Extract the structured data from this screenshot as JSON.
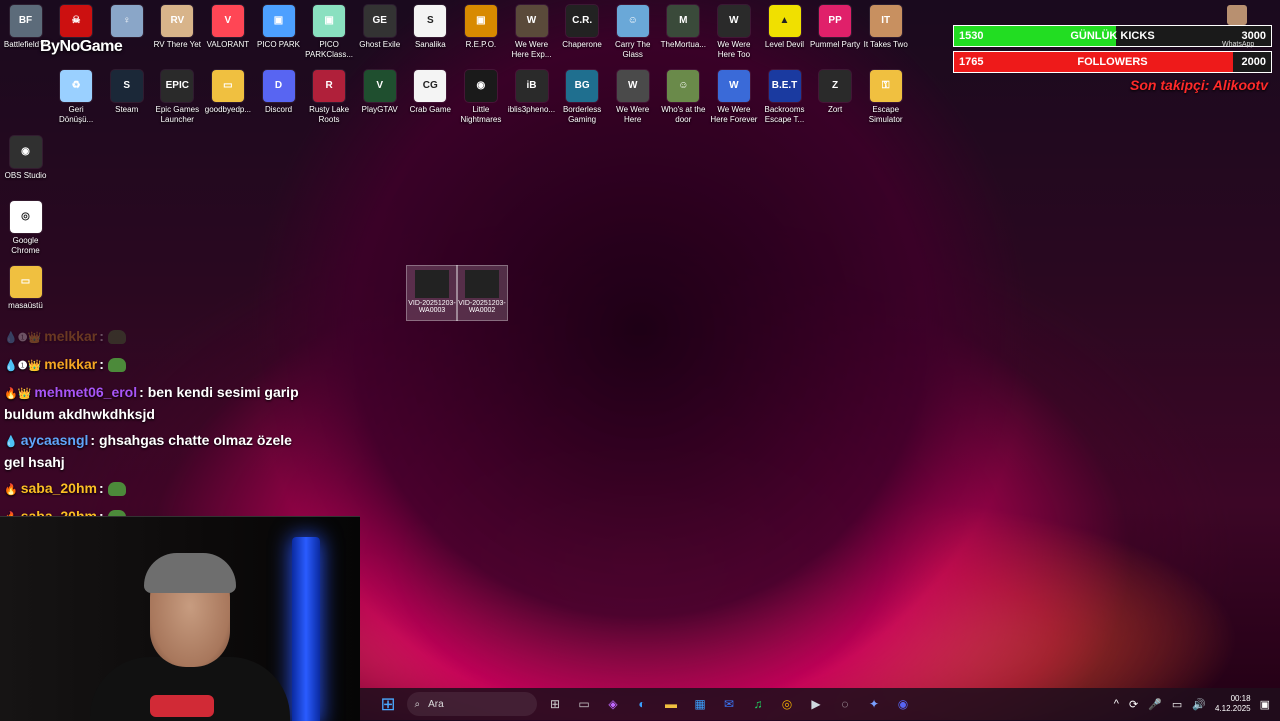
{
  "desktop_row1": [
    {
      "label": "Battlefield™",
      "color": "#5c6b7a",
      "glyph": "BF"
    },
    {
      "label": "",
      "color": "#cc1010",
      "glyph": "☠"
    },
    {
      "label": "",
      "color": "#8aa6c8",
      "glyph": "♀"
    },
    {
      "label": "RV There Yet",
      "color": "#d8b48a",
      "glyph": "RV"
    },
    {
      "label": "VALORANT",
      "color": "#ff4655",
      "glyph": "V"
    },
    {
      "label": "PICO PARK",
      "color": "#4da0ff",
      "glyph": "▣"
    },
    {
      "label": "PICO PARKClass...",
      "color": "#8ae0c0",
      "glyph": "▣"
    },
    {
      "label": "Ghost Exile",
      "color": "#333333",
      "glyph": "GE"
    },
    {
      "label": "Sanalika",
      "color": "#f4f4f4",
      "glyph": "S"
    },
    {
      "label": "R.E.P.O.",
      "color": "#d88a00",
      "glyph": "▣"
    },
    {
      "label": "We Were Here Exp...",
      "color": "#5a4a3a",
      "glyph": "W"
    },
    {
      "label": "Chaperone",
      "color": "#222222",
      "glyph": "C.R."
    },
    {
      "label": "Carry The Glass",
      "color": "#6aa8d8",
      "glyph": "☺"
    },
    {
      "label": "TheMortua...",
      "color": "#3a4a3a",
      "glyph": "M"
    },
    {
      "label": "We Were Here Too",
      "color": "#2a2a2a",
      "glyph": "W"
    },
    {
      "label": "Level Devil",
      "color": "#f0e000",
      "glyph": "▲"
    },
    {
      "label": "Pummel Party",
      "color": "#e0206a",
      "glyph": "PP"
    },
    {
      "label": "It Takes Two",
      "color": "#c89060",
      "glyph": "IT"
    }
  ],
  "desktop_row2": [
    {
      "label": "Geri Dönüşü...",
      "color": "#9ad0ff",
      "glyph": "♻"
    },
    {
      "label": "Steam",
      "color": "#1b2838",
      "glyph": "S"
    },
    {
      "label": "Epic Games Launcher",
      "color": "#2a2a2a",
      "glyph": "EPIC"
    },
    {
      "label": "goodbyedp...",
      "color": "#f0c040",
      "glyph": "▭"
    },
    {
      "label": "Discord",
      "color": "#5865f2",
      "glyph": "D"
    },
    {
      "label": "Rusty Lake Roots",
      "color": "#b0203a",
      "glyph": "R"
    },
    {
      "label": "PlayGTAV",
      "color": "#1f4f2f",
      "glyph": "V"
    },
    {
      "label": "Crab Game",
      "color": "#f4f4f4",
      "glyph": "CG"
    },
    {
      "label": "Little Nightmares",
      "color": "#1a1a1a",
      "glyph": "◉"
    },
    {
      "label": "iblis3pheno...",
      "color": "#2a2a2a",
      "glyph": "iB"
    },
    {
      "label": "Borderless Gaming",
      "color": "#1f6f8f",
      "glyph": "BG"
    },
    {
      "label": "We Were Here",
      "color": "#4a4a4a",
      "glyph": "W"
    },
    {
      "label": "Who's at the door",
      "color": "#6a8a4a",
      "glyph": "☺"
    },
    {
      "label": "We Were Here Forever",
      "color": "#3a6ad8",
      "glyph": "W"
    },
    {
      "label": "Backrooms Escape T...",
      "color": "#1a3aa0",
      "glyph": "B.E.T"
    },
    {
      "label": "Zort",
      "color": "#2a2a2a",
      "glyph": "Z"
    },
    {
      "label": "Escape Simulator",
      "color": "#f0c040",
      "glyph": "⚿"
    }
  ],
  "desktop_col": [
    {
      "label": "OBS Studio",
      "color": "#303030",
      "glyph": "◉"
    },
    {
      "label": "Google Chrome",
      "color": "#ffffff",
      "glyph": "◎"
    },
    {
      "label": "masaüstü",
      "color": "#f0c040",
      "glyph": "▭"
    }
  ],
  "overlay": {
    "brand": "ByNoGame",
    "kicks": {
      "current": "1530",
      "name": "GÜNLÜK KICKS",
      "goal": "3000",
      "fill": 0.51,
      "color": "#22dd22"
    },
    "followers": {
      "current": "1765",
      "name": "FOLLOWERS",
      "goal": "2000",
      "fill": 0.88,
      "color": "#ee1a1a"
    },
    "last_follower": "Son takipçi: Alikootv",
    "whatsapp": "WhatsApp"
  },
  "files": [
    {
      "label": "VID-20251203-WA0003"
    },
    {
      "label": "VID-20251203-WA0002"
    }
  ],
  "chat": [
    {
      "user": "melkkar",
      "color": "#f5a623",
      "badges": "💧❶👑",
      "text": "",
      "emote": true
    },
    {
      "user": "melkkar",
      "color": "#f5a623",
      "badges": "💧❶👑",
      "text": "",
      "emote": true
    },
    {
      "user": "mehmet06_erol",
      "color": "#a855f7",
      "badges": "🔥👑",
      "text": "ben kendi sesimi garip buldum akdhwkdhksjd",
      "emote": false
    },
    {
      "user": "aycaasngl",
      "color": "#60a5fa",
      "badges": "💧",
      "text": "ghsahgas chatte olmaz özele gel hsahj",
      "emote": false
    },
    {
      "user": "saba_20hm",
      "color": "#fbbf24",
      "badges": "🔥",
      "text": "",
      "emote": true
    },
    {
      "user": "saba_20hm",
      "color": "#fbbf24",
      "badges": "🔥",
      "text": "",
      "emote": true
    }
  ],
  "taskbar": {
    "search_placeholder": "Ara",
    "apps": [
      "⊞",
      "▭",
      "◈",
      "◐",
      "▬",
      "▦",
      "✉",
      "♫",
      "◎",
      "▶",
      "◌",
      "✦",
      "◉"
    ],
    "time": "00:18",
    "date": "4.12.2025",
    "tray_icons": [
      "^",
      "⟳",
      "🎤",
      "▭",
      "🔊"
    ]
  }
}
